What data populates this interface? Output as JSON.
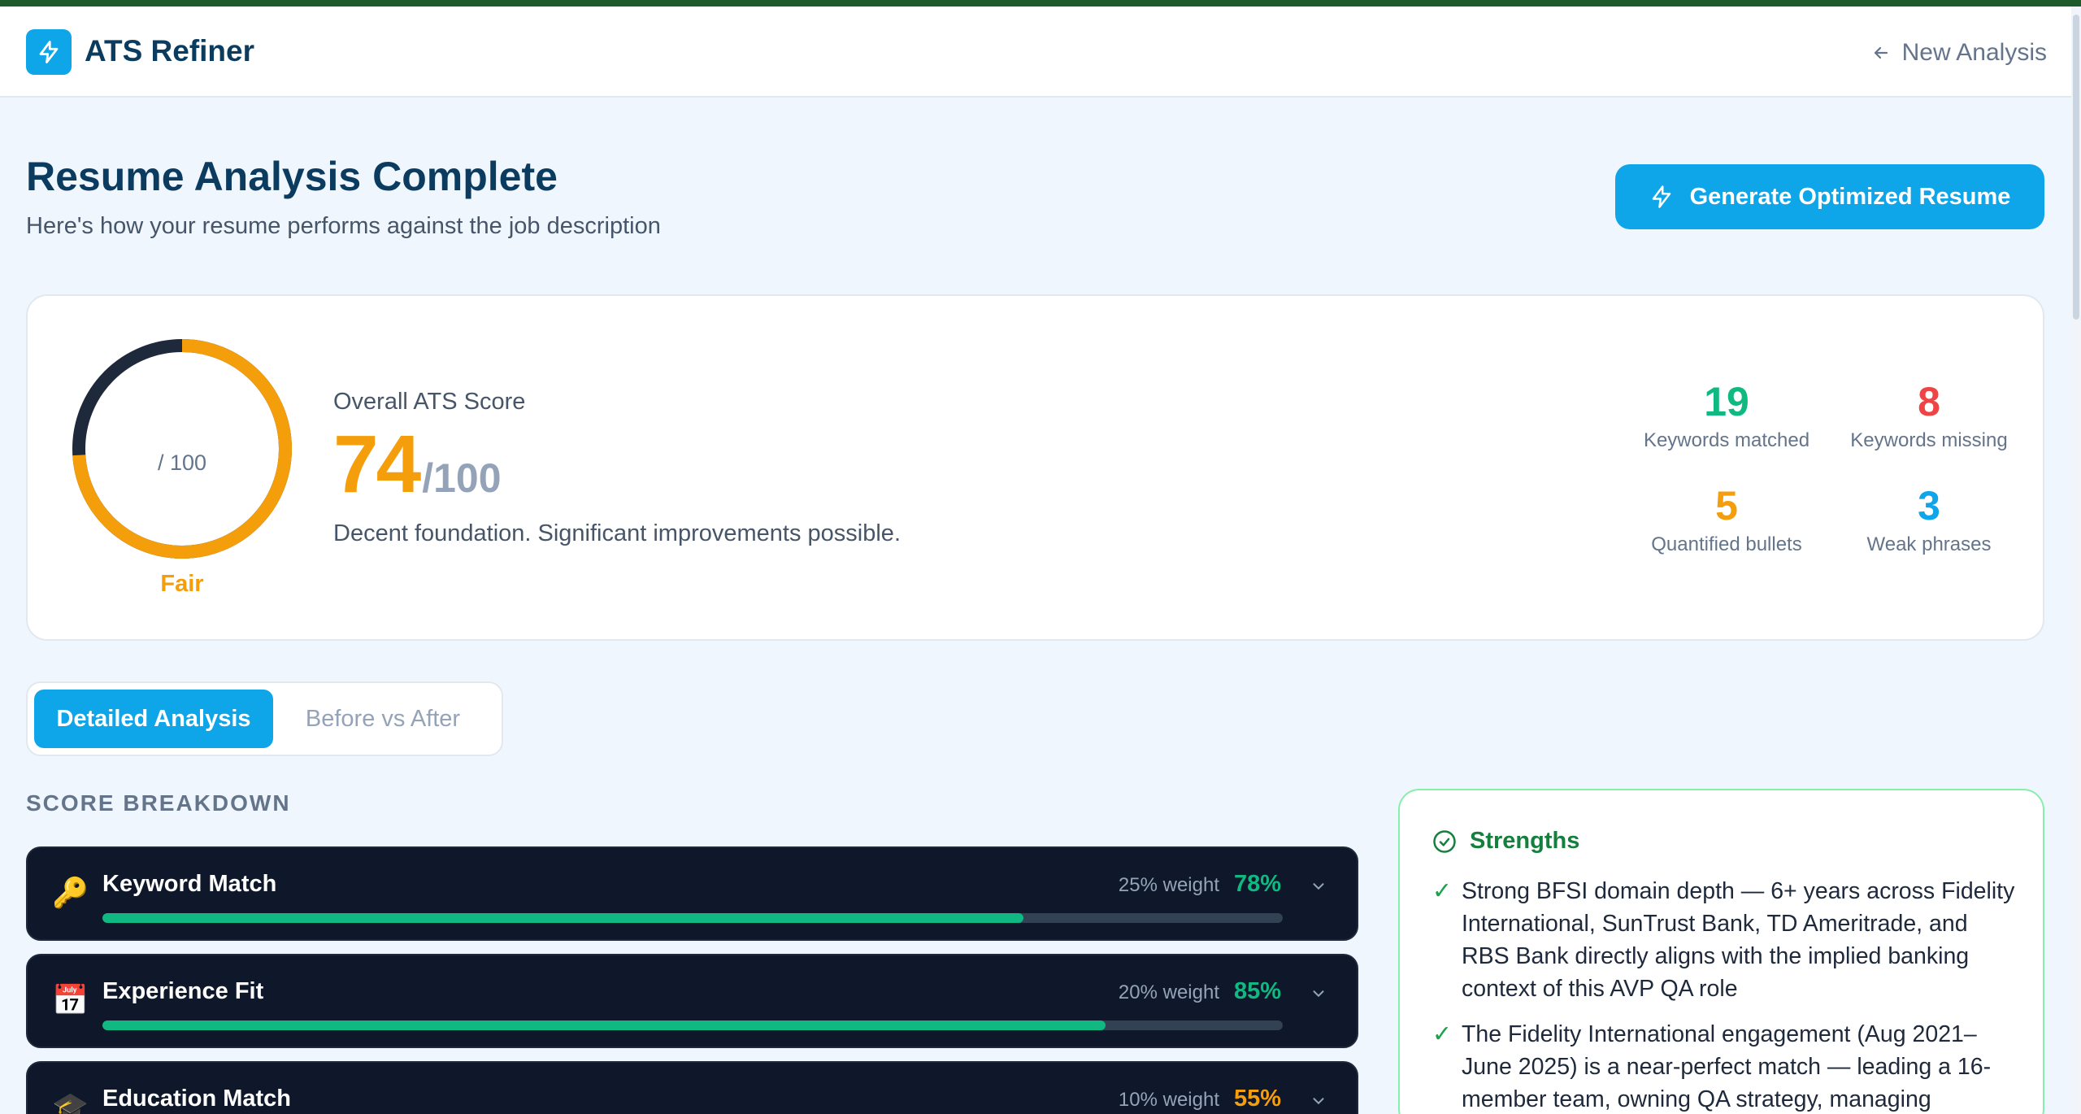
{
  "app": {
    "name": "ATS Refiner",
    "new_analysis_label": "New Analysis"
  },
  "page": {
    "title": "Resume Analysis Complete",
    "subtitle": "Here's how your resume performs against the job description",
    "generate_label": "Generate Optimized Resume"
  },
  "score": {
    "value": 74,
    "value_text": "74",
    "out_of_text": "/100",
    "ring_caption": "/ 100",
    "label": "Overall ATS Score",
    "rating": "Fair",
    "description": "Decent foundation. Significant improvements possible.",
    "ring_color": "#f59e0b"
  },
  "stats": [
    {
      "value": "19",
      "label": "Keywords matched",
      "color": "#10b981"
    },
    {
      "value": "8",
      "label": "Keywords missing",
      "color": "#ef4444"
    },
    {
      "value": "5",
      "label": "Quantified bullets",
      "color": "#f59e0b"
    },
    {
      "value": "3",
      "label": "Weak phrases",
      "color": "#0ea5e9"
    }
  ],
  "tabs": [
    {
      "label": "Detailed Analysis",
      "active": true
    },
    {
      "label": "Before vs After",
      "active": false
    }
  ],
  "breakdown": {
    "heading": "SCORE BREAKDOWN",
    "items": [
      {
        "icon": "key-icon",
        "icon_glyph": "🔑",
        "name": "Keyword Match",
        "weight": "25% weight",
        "pct": "78%",
        "value": 78,
        "color": "#10b981"
      },
      {
        "icon": "calendar-icon",
        "icon_glyph": "📅",
        "name": "Experience Fit",
        "weight": "20% weight",
        "pct": "85%",
        "value": 85,
        "color": "#10b981"
      },
      {
        "icon": "graduation-cap-icon",
        "icon_glyph": "🎓",
        "name": "Education Match",
        "weight": "10% weight",
        "pct": "55%",
        "value": 55,
        "color": "#f59e0b"
      }
    ]
  },
  "strengths": {
    "title": "Strengths",
    "items": [
      "Strong BFSI domain depth — 6+ years across Fidelity International, SunTrust Bank, TD Ameritrade, and RBS Bank directly aligns with the implied banking context of this AVP QA role",
      "The Fidelity International engagement (Aug 2021–June 2025) is a near-perfect match — leading a 16-member team, owning QA strategy, managing"
    ]
  }
}
